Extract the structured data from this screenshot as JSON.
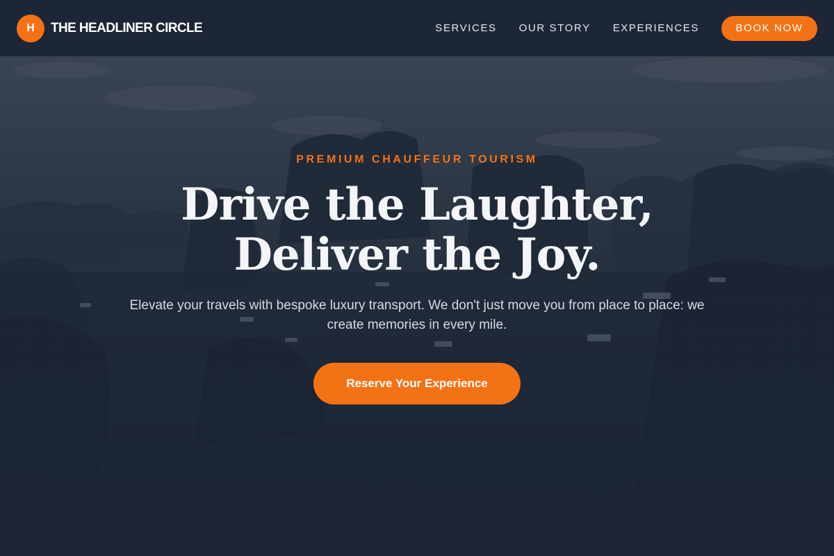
{
  "brand": {
    "logo_letter": "H",
    "name": "THE HEADLINER CIRCLE"
  },
  "nav": {
    "items": [
      {
        "label": "SERVICES"
      },
      {
        "label": "OUR STORY"
      },
      {
        "label": "EXPERIENCES"
      }
    ],
    "cta_label": "BOOK NOW"
  },
  "hero": {
    "eyebrow": "PREMIUM CHAUFFEUR TOURISM",
    "headline_line1": "Drive the Laughter,",
    "headline_line2": "Deliver the Joy.",
    "subtext": "Elevate your travels with bespoke luxury transport. We don't just move you from place to place: we create memories in every mile.",
    "cta_label": "Reserve Your Experience"
  },
  "colors": {
    "accent": "#f47216",
    "header_bg": "#1d2636",
    "headline": "#f4f5f7"
  }
}
